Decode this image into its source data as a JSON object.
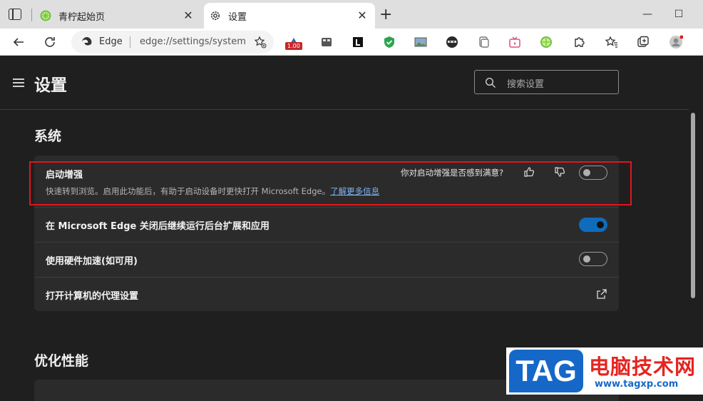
{
  "tabs": [
    {
      "title": "青柠起始页",
      "active": false
    },
    {
      "title": "设置",
      "active": true
    }
  ],
  "address": {
    "site_label": "Edge",
    "url": "edge://settings/system"
  },
  "extension_badge": "1.00",
  "page": {
    "title": "设置",
    "search_placeholder": "搜索设置"
  },
  "sections": [
    {
      "title": "系统"
    },
    {
      "title": "优化性能"
    }
  ],
  "system_rows": [
    {
      "title": "启动增强",
      "description": "快速转到浏览。启用此功能后，有助于启动设备时更快打开 Microsoft Edge。",
      "link": "了解更多信息",
      "feedback": "你对启动增强是否感到满意?",
      "enabled": false
    },
    {
      "title": "在 Microsoft Edge 关闭后继续运行后台扩展和应用",
      "enabled": true
    },
    {
      "title": "使用硬件加速(如可用)",
      "enabled": false
    },
    {
      "title": "打开计算机的代理设置"
    }
  ],
  "watermark": {
    "tag": "TAG",
    "name": "电脑技术网",
    "url": "www.tagxp.com"
  },
  "colors": {
    "accent": "#0f6cbd",
    "highlight": "#e5141b",
    "link": "#7fb3f2"
  }
}
